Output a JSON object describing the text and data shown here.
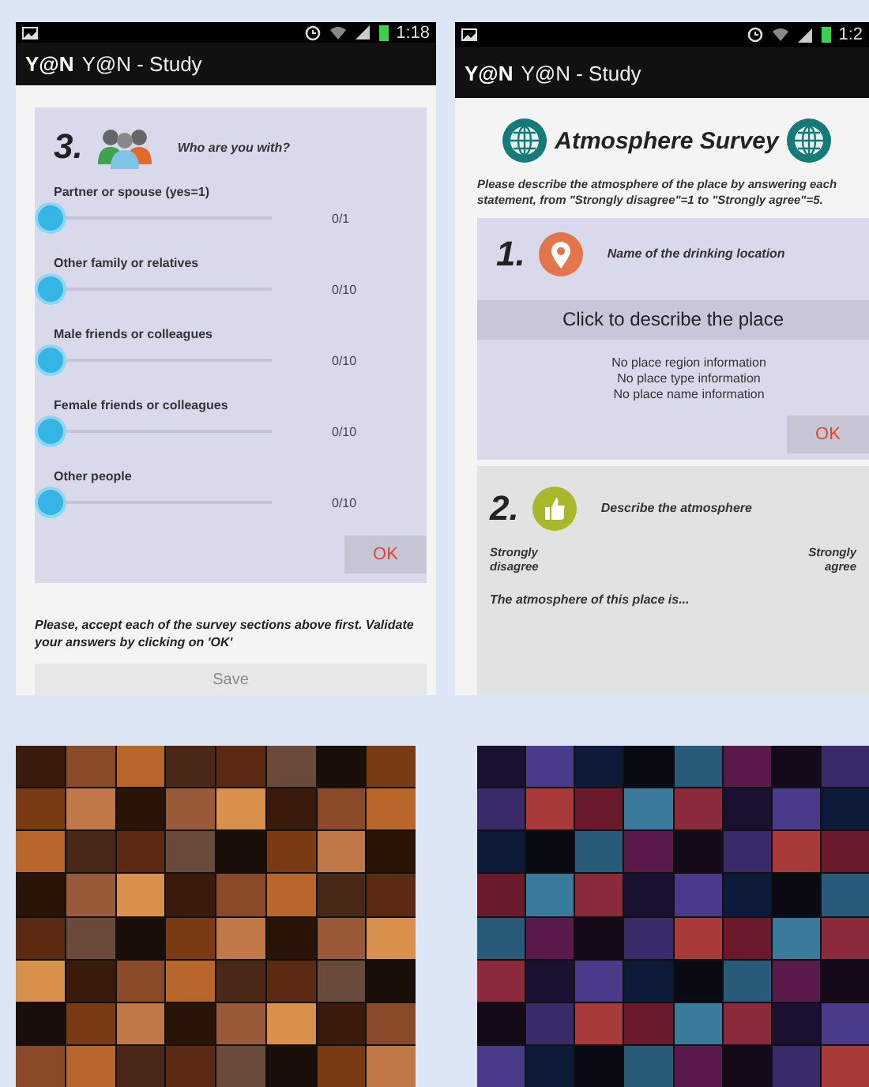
{
  "phones": [
    {
      "kind": "who",
      "status_time": "1:18",
      "logo": "Y@N",
      "title": "Y@N - Study",
      "section": {
        "number": "3.",
        "question": "Who are you with?",
        "ok": "OK",
        "sliders": [
          {
            "label": "Partner or spouse (yes=1)",
            "reading": "0/1",
            "level": 0
          },
          {
            "label": "Other family or relatives",
            "reading": "0/10",
            "level": 0
          },
          {
            "label": "Male friends or colleagues",
            "reading": "0/10",
            "level": 0
          },
          {
            "label": "Female friends or colleagues",
            "reading": "0/10",
            "level": 0
          },
          {
            "label": "Other people",
            "reading": "0/10",
            "level": 0
          }
        ]
      },
      "note": "Please, accept each of the survey sections above first. Validate your answers by clicking on 'OK'",
      "save": {
        "label": "Save",
        "disabled": true
      }
    },
    {
      "kind": "atmosphere",
      "status_time": "1:2",
      "logo": "Y@N",
      "title": "Y@N - Study",
      "heading": "Atmosphere Survey",
      "intro": "Please describe the atmosphere of the place by answering each statement, from \"Strongly disagree\"=1 to \"Strongly agree\"=5.",
      "place": {
        "number": "1.",
        "title": "Name of the drinking location",
        "button": "Click to describe the place",
        "info": [
          "No place region information",
          "No place type information",
          "No place name information"
        ],
        "ok": "OK"
      },
      "atmosphere": {
        "number": "2.",
        "title": "Describe the atmosphere",
        "scale_left": "Strongly disagree",
        "scale_right": "Strongly agree",
        "statement": "The atmosphere of this place is..."
      }
    }
  ]
}
